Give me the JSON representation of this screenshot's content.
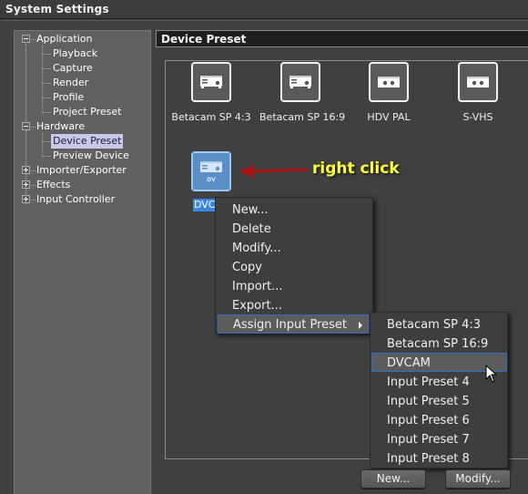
{
  "window": {
    "title": "System Settings"
  },
  "tree": {
    "items": [
      {
        "label": "Application",
        "level": 0,
        "expander": "minus"
      },
      {
        "label": "Playback",
        "level": 1
      },
      {
        "label": "Capture",
        "level": 1
      },
      {
        "label": "Render",
        "level": 1
      },
      {
        "label": "Profile",
        "level": 1
      },
      {
        "label": "Project Preset",
        "level": 1
      },
      {
        "label": "Hardware",
        "level": 0,
        "expander": "minus"
      },
      {
        "label": "Device Preset",
        "level": 1,
        "selected": true
      },
      {
        "label": "Preview Device",
        "level": 1
      },
      {
        "label": "Importer/Exporter",
        "level": 0,
        "expander": "plus"
      },
      {
        "label": "Effects",
        "level": 0,
        "expander": "plus"
      },
      {
        "label": "Input Controller",
        "level": 0,
        "expander": "plus"
      }
    ]
  },
  "panel": {
    "title": "Device Preset",
    "presets": [
      {
        "name": "Betacam SP 4:3",
        "icon": "deck-icon"
      },
      {
        "name": "Betacam SP 16:9",
        "icon": "deck-icon"
      },
      {
        "name": "HDV PAL",
        "icon": "cassette-icon"
      },
      {
        "name": "S-VHS",
        "icon": "cassette-icon"
      }
    ],
    "selected_preset": {
      "name": "DVCAM",
      "icon": "deck-icon",
      "badge": "DV"
    }
  },
  "annotation": {
    "text": "right click",
    "color": "#ffff33",
    "arrow_color": "#b01010"
  },
  "context_menu": {
    "items": [
      {
        "label": "New..."
      },
      {
        "label": "Delete"
      },
      {
        "label": "Modify..."
      },
      {
        "label": "Copy"
      },
      {
        "label": "Import..."
      },
      {
        "label": "Export..."
      },
      {
        "label": "Assign Input Preset",
        "submenu": true,
        "highlighted": true
      }
    ]
  },
  "submenu": {
    "items": [
      {
        "label": "Betacam SP 4:3"
      },
      {
        "label": "Betacam SP 16:9"
      },
      {
        "label": "DVCAM",
        "highlighted": true
      },
      {
        "label": "Input Preset 4"
      },
      {
        "label": "Input Preset 5"
      },
      {
        "label": "Input Preset 6"
      },
      {
        "label": "Input Preset 7"
      },
      {
        "label": "Input Preset 8"
      }
    ]
  },
  "buttons": {
    "new_label": "New...",
    "modify_label": "Modify..."
  },
  "colors": {
    "highlight_border": "#2f6ec9",
    "selection_blue": "#3a86e0",
    "tree_selected": "#c8c8e8"
  }
}
